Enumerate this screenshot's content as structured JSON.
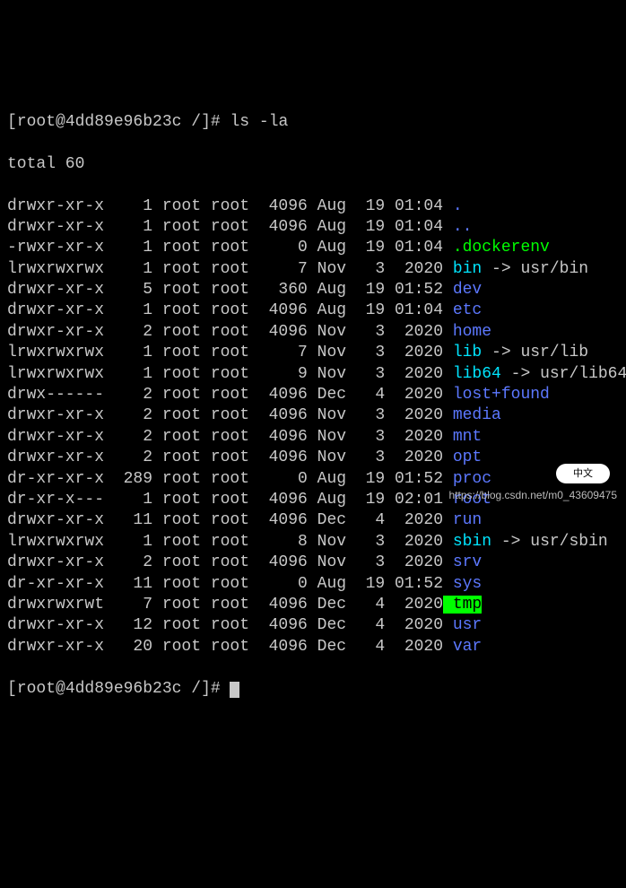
{
  "prompt": {
    "open": "[",
    "user_host": "root@4dd89e96b23c",
    "sep": " ",
    "path": "/",
    "close": "]# ",
    "command": "ls -la"
  },
  "total_line": "total 60",
  "rows": [
    {
      "perm": "drwxr-xr-x",
      "links": "1",
      "owner": "root",
      "group": "root",
      "size": "4096",
      "month": "Aug",
      "day": "19",
      "time": "01:04",
      "name": ".",
      "color": "blue"
    },
    {
      "perm": "drwxr-xr-x",
      "links": "1",
      "owner": "root",
      "group": "root",
      "size": "4096",
      "month": "Aug",
      "day": "19",
      "time": "01:04",
      "name": "..",
      "color": "blue"
    },
    {
      "perm": "-rwxr-xr-x",
      "links": "1",
      "owner": "root",
      "group": "root",
      "size": "0",
      "month": "Aug",
      "day": "19",
      "time": "01:04",
      "name": ".dockerenv",
      "color": "green"
    },
    {
      "perm": "lrwxrwxrwx",
      "links": "1",
      "owner": "root",
      "group": "root",
      "size": "7",
      "month": "Nov",
      "day": "3",
      "time": "2020",
      "name": "bin",
      "color": "cyan",
      "arrow": " -> ",
      "target": "usr/bin",
      "target_color": "default"
    },
    {
      "perm": "drwxr-xr-x",
      "links": "5",
      "owner": "root",
      "group": "root",
      "size": "360",
      "month": "Aug",
      "day": "19",
      "time": "01:52",
      "name": "dev",
      "color": "blue"
    },
    {
      "perm": "drwxr-xr-x",
      "links": "1",
      "owner": "root",
      "group": "root",
      "size": "4096",
      "month": "Aug",
      "day": "19",
      "time": "01:04",
      "name": "etc",
      "color": "blue"
    },
    {
      "perm": "drwxr-xr-x",
      "links": "2",
      "owner": "root",
      "group": "root",
      "size": "4096",
      "month": "Nov",
      "day": "3",
      "time": "2020",
      "name": "home",
      "color": "blue"
    },
    {
      "perm": "lrwxrwxrwx",
      "links": "1",
      "owner": "root",
      "group": "root",
      "size": "7",
      "month": "Nov",
      "day": "3",
      "time": "2020",
      "name": "lib",
      "color": "cyan",
      "arrow": " -> ",
      "target": "usr/lib",
      "target_color": "default"
    },
    {
      "perm": "lrwxrwxrwx",
      "links": "1",
      "owner": "root",
      "group": "root",
      "size": "9",
      "month": "Nov",
      "day": "3",
      "time": "2020",
      "name": "lib64",
      "color": "cyan",
      "arrow": " -> ",
      "target": "usr/lib64",
      "target_color": "default"
    },
    {
      "perm": "drwx------",
      "links": "2",
      "owner": "root",
      "group": "root",
      "size": "4096",
      "month": "Dec",
      "day": "4",
      "time": "2020",
      "name": "lost+found",
      "color": "blue"
    },
    {
      "perm": "drwxr-xr-x",
      "links": "2",
      "owner": "root",
      "group": "root",
      "size": "4096",
      "month": "Nov",
      "day": "3",
      "time": "2020",
      "name": "media",
      "color": "blue"
    },
    {
      "perm": "drwxr-xr-x",
      "links": "2",
      "owner": "root",
      "group": "root",
      "size": "4096",
      "month": "Nov",
      "day": "3",
      "time": "2020",
      "name": "mnt",
      "color": "blue"
    },
    {
      "perm": "drwxr-xr-x",
      "links": "2",
      "owner": "root",
      "group": "root",
      "size": "4096",
      "month": "Nov",
      "day": "3",
      "time": "2020",
      "name": "opt",
      "color": "blue"
    },
    {
      "perm": "dr-xr-xr-x",
      "links": "289",
      "owner": "root",
      "group": "root",
      "size": "0",
      "month": "Aug",
      "day": "19",
      "time": "01:52",
      "name": "proc",
      "color": "blue"
    },
    {
      "perm": "dr-xr-x---",
      "links": "1",
      "owner": "root",
      "group": "root",
      "size": "4096",
      "month": "Aug",
      "day": "19",
      "time": "02:01",
      "name": "root",
      "color": "blue"
    },
    {
      "perm": "drwxr-xr-x",
      "links": "11",
      "owner": "root",
      "group": "root",
      "size": "4096",
      "month": "Dec",
      "day": "4",
      "time": "2020",
      "name": "run",
      "color": "blue"
    },
    {
      "perm": "lrwxrwxrwx",
      "links": "1",
      "owner": "root",
      "group": "root",
      "size": "8",
      "month": "Nov",
      "day": "3",
      "time": "2020",
      "name": "sbin",
      "color": "cyan",
      "arrow": " -> ",
      "target": "usr/sbin",
      "target_color": "default"
    },
    {
      "perm": "drwxr-xr-x",
      "links": "2",
      "owner": "root",
      "group": "root",
      "size": "4096",
      "month": "Nov",
      "day": "3",
      "time": "2020",
      "name": "srv",
      "color": "blue"
    },
    {
      "perm": "dr-xr-xr-x",
      "links": "11",
      "owner": "root",
      "group": "root",
      "size": "0",
      "month": "Aug",
      "day": "19",
      "time": "01:52",
      "name": "sys",
      "color": "blue"
    },
    {
      "perm": "drwxrwxrwt",
      "links": "7",
      "owner": "root",
      "group": "root",
      "size": "4096",
      "month": "Dec",
      "day": "4",
      "time": "2020",
      "name": "tmp",
      "color": "bg-green"
    },
    {
      "perm": "drwxr-xr-x",
      "links": "12",
      "owner": "root",
      "group": "root",
      "size": "4096",
      "month": "Dec",
      "day": "4",
      "time": "2020",
      "name": "usr",
      "color": "blue"
    },
    {
      "perm": "drwxr-xr-x",
      "links": "20",
      "owner": "root",
      "group": "root",
      "size": "4096",
      "month": "Dec",
      "day": "4",
      "time": "2020",
      "name": "var",
      "color": "blue"
    }
  ],
  "prompt2": {
    "open": "[",
    "user_host": "root@4dd89e96b23c",
    "sep": " ",
    "path": "/",
    "close": "]# "
  },
  "watermark": "https://blog.csdn.net/m0_43609475",
  "badge": "中文"
}
